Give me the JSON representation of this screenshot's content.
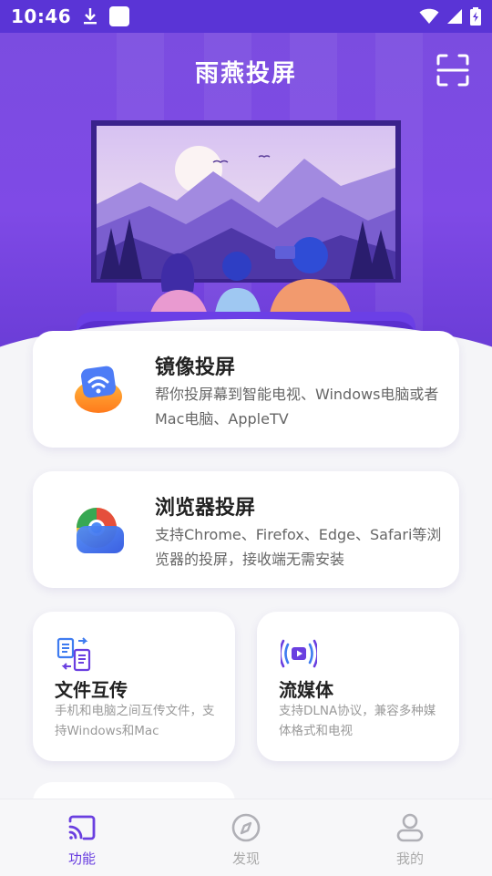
{
  "status_bar": {
    "time": "10:46"
  },
  "header": {
    "title": "雨燕投屏"
  },
  "cards": [
    {
      "title": "镜像投屏",
      "desc": "帮你投屏幕到智能电视、Windows电脑或者Mac电脑、AppleTV"
    },
    {
      "title": "浏览器投屏",
      "desc": "支持Chrome、Firefox、Edge、Safari等浏览器的投屏，接收端无需安装"
    },
    {
      "title": "文件互传",
      "desc": "手机和电脑之间互传文件，支持Windows和Mac"
    },
    {
      "title": "流媒体",
      "desc": "支持DLNA协议，兼容多种媒体格式和电视"
    }
  ],
  "tabbar": {
    "tabs": [
      {
        "label": "功能"
      },
      {
        "label": "发现"
      },
      {
        "label": "我的"
      }
    ]
  },
  "colors": {
    "primary": "#7b4ce0",
    "tab_active": "#6a3fe0",
    "tab_inactive": "#aaaaaa"
  }
}
